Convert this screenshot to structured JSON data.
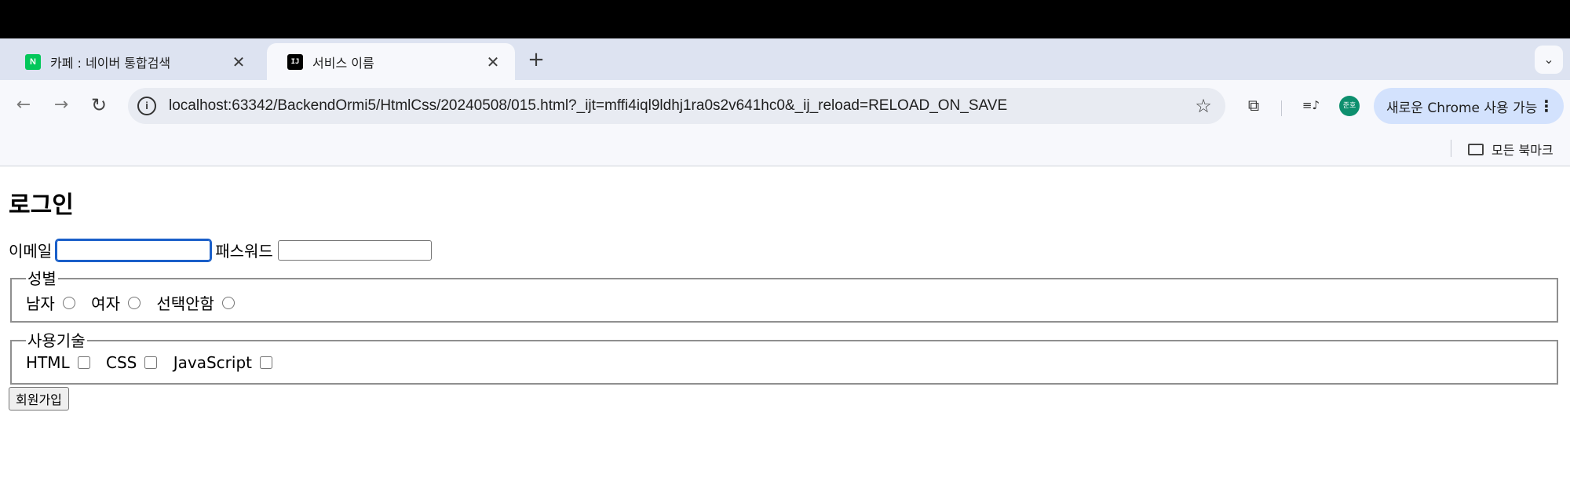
{
  "tabs": [
    {
      "title": "카페 : 네이버 통합검색",
      "favicon": "N",
      "active": false
    },
    {
      "title": "서비스 이름",
      "favicon": "IJ",
      "active": true
    }
  ],
  "tab_close_glyph": "✕",
  "new_tab_glyph": "+",
  "tab_search_glyph": "⌄",
  "toolbar": {
    "back_glyph": "←",
    "forward_glyph": "→",
    "reload_glyph": "↻",
    "site_info_glyph": "i",
    "url": "localhost:63342/BackendOrmi5/HtmlCss/20240508/015.html?_ijt=mffi4iql9ldhj1ra0s2v641hc0&_ij_reload=RELOAD_ON_SAVE",
    "star_glyph": "☆",
    "extensions_glyph": "⧉",
    "media_glyph": "≡♪",
    "avatar_text": "준호",
    "update_label": "새로운 Chrome 사용 가능",
    "menu_glyph": "⋮"
  },
  "bookmarks": {
    "all_label": "모든 북마크"
  },
  "page": {
    "title": "로그인",
    "email_label": "이메일",
    "password_label": "패스워드",
    "email_value": "",
    "password_value": "",
    "gender": {
      "legend": "성별",
      "options": [
        "남자",
        "여자",
        "선택안함"
      ]
    },
    "skills": {
      "legend": "사용기술",
      "options": [
        "HTML",
        "CSS",
        "JavaScript"
      ]
    },
    "signup_label": "회원가입"
  },
  "colors": {
    "tabstrip": "#dde3f1",
    "toolbar": "#f7f8fc",
    "omnibox": "#e8ebf2",
    "update_chip": "#d3e2fd",
    "focus_ring": "#1a5fc9"
  }
}
